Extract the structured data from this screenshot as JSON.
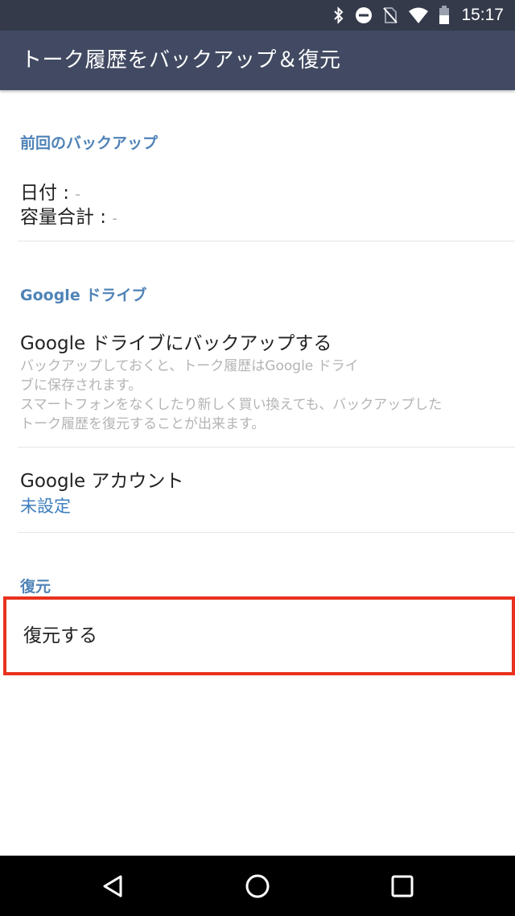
{
  "status_bar": {
    "time": "15:17",
    "icons": [
      "bluetooth-icon",
      "do-not-disturb-icon",
      "no-sim-icon",
      "wifi-icon",
      "battery-icon"
    ]
  },
  "app_bar": {
    "title": "トーク履歴をバックアップ＆復元"
  },
  "sections": {
    "last_backup": {
      "header": "前回のバックアップ",
      "date_label": "日付 :",
      "date_value": "-",
      "size_label": "容量合計 :",
      "size_value": "-"
    },
    "google_drive": {
      "header": "Google ドライブ",
      "backup_title": "Google ドライブにバックアップする",
      "backup_desc_line1": "バックアップしておくと、トーク履歴はGoogle ドライ",
      "backup_desc_line2": "ブに保存されます。",
      "backup_desc_line3": "スマートフォンをなくしたり新しく買い換えても、バックアップした",
      "backup_desc_line4": "トーク履歴を復元することが出来ます。",
      "account_title": "Google アカウント",
      "account_value": "未設定"
    },
    "restore": {
      "header": "復元",
      "restore_action": "復元する"
    }
  },
  "colors": {
    "status_bar": "#343a4a",
    "app_bar": "#414a62",
    "section_header": "#4f83b7",
    "link": "#3d7fbf",
    "highlight_border": "#e8321e"
  },
  "nav_bar": {
    "icons": [
      "back-icon",
      "home-icon",
      "recents-icon"
    ]
  }
}
